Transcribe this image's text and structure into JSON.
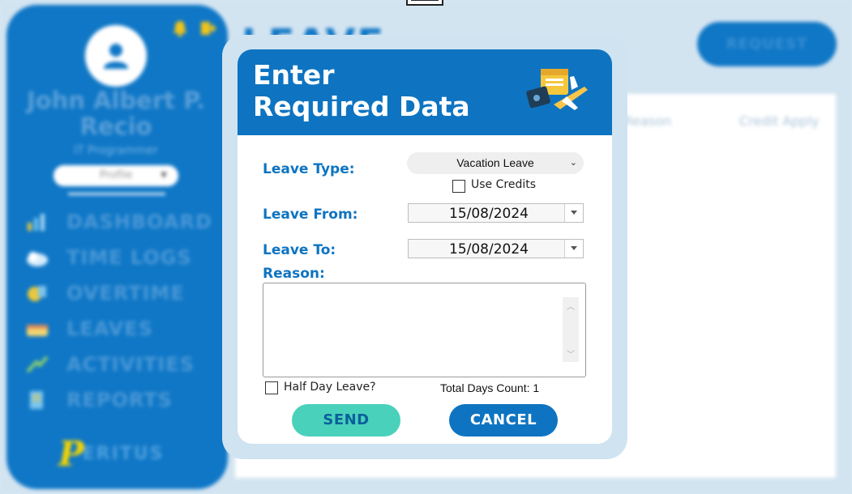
{
  "sidebar": {
    "user_name": "John Albert P. Recio",
    "user_role": "IT Programmer",
    "profile_select": "Profile",
    "nav": [
      {
        "label": "DASHBOARD",
        "icon": "chart-icon"
      },
      {
        "label": "TIME LOGS",
        "icon": "clock-icon"
      },
      {
        "label": "OVERTIME",
        "icon": "overtime-icon"
      },
      {
        "label": "LEAVES",
        "icon": "leave-icon"
      },
      {
        "label": "ACTIVITIES",
        "icon": "activities-icon"
      },
      {
        "label": "REPORTS",
        "icon": "report-icon"
      }
    ],
    "logo_text": "ERITUS",
    "logo_letter": "P"
  },
  "header": {
    "title": "LEAVE",
    "request_button": "REQUEST"
  },
  "table": {
    "columns": [
      "Reason",
      "Credit Apply"
    ]
  },
  "dialog": {
    "title_line1": "Enter",
    "title_line2": "Required Data",
    "leave_type_label": "Leave Type:",
    "leave_type_value": "Vacation Leave",
    "use_credits_label": "Use Credits",
    "leave_from_label": "Leave From:",
    "leave_from_value": "15/08/2024",
    "leave_to_label": "Leave To:",
    "leave_to_value": "15/08/2024",
    "reason_label": "Reason:",
    "reason_value": "",
    "half_day_label": "Half Day Leave?",
    "total_days_label": "Total Days Count: 1",
    "send_button": "SEND",
    "cancel_button": "CANCEL"
  },
  "colors": {
    "primary": "#0e74c1",
    "send": "#4ad1bb",
    "background": "#d3e4f1"
  }
}
